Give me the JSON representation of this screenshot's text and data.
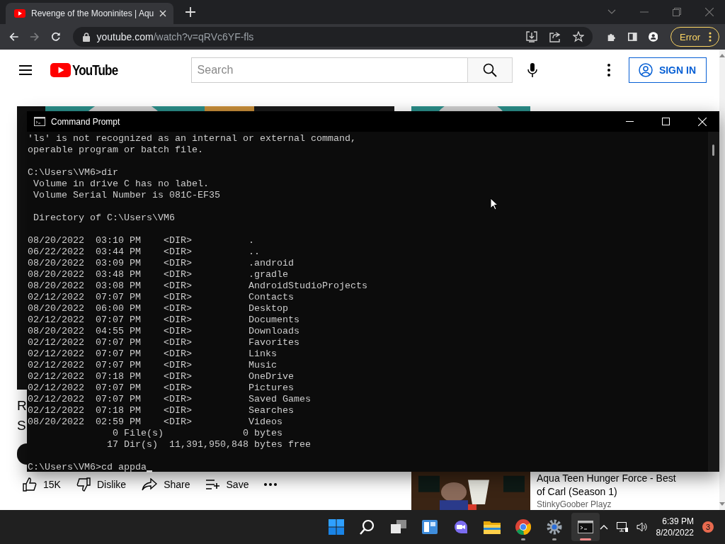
{
  "browser": {
    "tabs": [
      {
        "title": "Revenge of the Mooninites | Aqu",
        "selected": true
      }
    ],
    "nav_buttons": [
      {
        "kind": "back",
        "disabled": false
      },
      {
        "kind": "forward",
        "disabled": true
      },
      {
        "kind": "reload",
        "disabled": false
      }
    ],
    "address": {
      "domain": "youtube.com",
      "path": "/watch?v=qRVc6YF-fls"
    },
    "profile_button": "Error"
  },
  "youtube": {
    "logo_text": "YouTube",
    "search": {
      "placeholder": "Search"
    },
    "sign_in": "SIGN IN",
    "video": {
      "title_fragments": [
        "R",
        "S"
      ],
      "actions": [
        {
          "kind": "like",
          "label": "15K"
        },
        {
          "kind": "dislike",
          "label": "Dislike"
        },
        {
          "kind": "share",
          "label": "Share"
        },
        {
          "kind": "save",
          "label": "Save"
        },
        {
          "kind": "more"
        }
      ]
    },
    "related": [
      {
        "title": "Aqua Teen Hunger Force - Best of Carl (Season 1)",
        "channel": "StinkyGoober Playz"
      }
    ]
  },
  "terminal": {
    "title": "Command Prompt",
    "blocks": [
      [
        "'ls' is not recognized as an internal or external command,",
        "operable program or batch file."
      ],
      [
        "C:\\Users\\VM6>dir",
        " Volume in drive C has no label.",
        " Volume Serial Number is 081C-EF35"
      ],
      [
        " Directory of C:\\Users\\VM6"
      ],
      [
        "08/20/2022  03:10 PM    <DIR>          .",
        "06/22/2022  03:44 PM    <DIR>          ..",
        "08/20/2022  03:09 PM    <DIR>          .android",
        "08/20/2022  03:48 PM    <DIR>          .gradle",
        "08/20/2022  03:08 PM    <DIR>          AndroidStudioProjects",
        "02/12/2022  07:07 PM    <DIR>          Contacts",
        "08/20/2022  06:00 PM    <DIR>          Desktop",
        "02/12/2022  07:07 PM    <DIR>          Documents",
        "08/20/2022  04:55 PM    <DIR>          Downloads",
        "02/12/2022  07:07 PM    <DIR>          Favorites",
        "02/12/2022  07:07 PM    <DIR>          Links",
        "02/12/2022  07:07 PM    <DIR>          Music",
        "02/12/2022  07:18 PM    <DIR>          OneDrive",
        "02/12/2022  07:07 PM    <DIR>          Pictures",
        "02/12/2022  07:07 PM    <DIR>          Saved Games",
        "02/12/2022  07:18 PM    <DIR>          Searches",
        "08/20/2022  02:59 PM    <DIR>          Videos",
        "               0 File(s)              0 bytes",
        "              17 Dir(s)  11,391,950,848 bytes free"
      ]
    ],
    "input": "C:\\Users\\VM6>cd appda"
  },
  "taskbar": {
    "apps": [
      {
        "kind": "start",
        "running": false,
        "active": false
      },
      {
        "kind": "search",
        "running": false,
        "active": false
      },
      {
        "kind": "task-view",
        "running": false,
        "active": false
      },
      {
        "kind": "widgets",
        "running": false,
        "active": false
      },
      {
        "kind": "chat",
        "running": false,
        "active": false
      },
      {
        "kind": "explorer",
        "running": false,
        "active": false
      },
      {
        "kind": "chrome",
        "running": true,
        "active": false
      },
      {
        "kind": "settings",
        "running": true,
        "active": false
      },
      {
        "kind": "terminal",
        "running": true,
        "active": true
      }
    ],
    "time": "6:39 PM",
    "date": "8/20/2022",
    "notifications": "3"
  }
}
